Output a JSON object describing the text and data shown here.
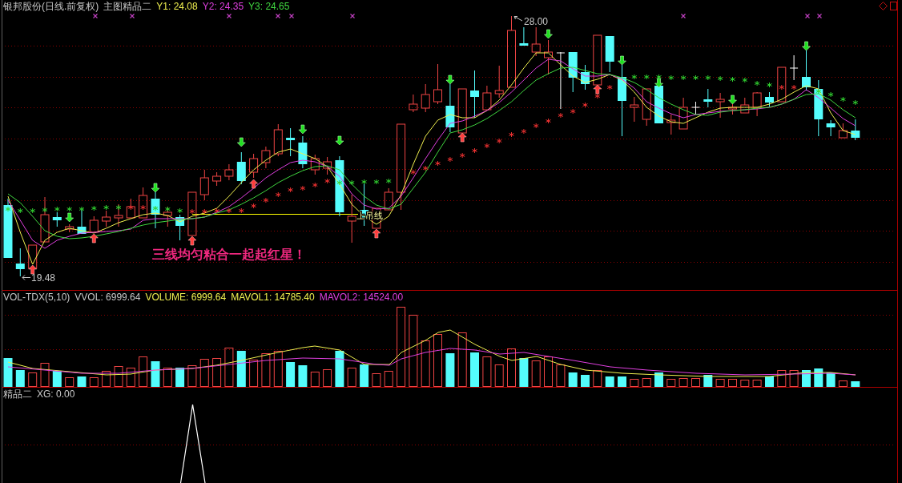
{
  "main_chart": {
    "title": "银邦股份(日线.前复权)",
    "formula": "主图精品二",
    "indicators": [
      {
        "text": "Y1: 24.08",
        "color": "#f0f050"
      },
      {
        "text": "Y2: 24.35",
        "color": "#e040e0"
      },
      {
        "text": "Y3: 24.65",
        "color": "#40d840"
      }
    ],
    "high_label": "28.00",
    "low_label": "19.48",
    "pattern_label": "上吊线",
    "annotation": "三线均匀粘合一起起红星！"
  },
  "volume_chart": {
    "indicators": [
      {
        "text": "VOL-TDX(5,10)"
      },
      {
        "text": "VVOL: 6999.64"
      },
      {
        "text": "VOLUME: 6999.64",
        "color": "#f0f050"
      },
      {
        "text": "MAVOL1: 14785.40",
        "color": "#f0f050"
      },
      {
        "text": "MAVOL2: 14524.00",
        "color": "#e040e0"
      }
    ]
  },
  "signal_chart": {
    "name": "精品二",
    "value": "XG: 0.00"
  }
}
